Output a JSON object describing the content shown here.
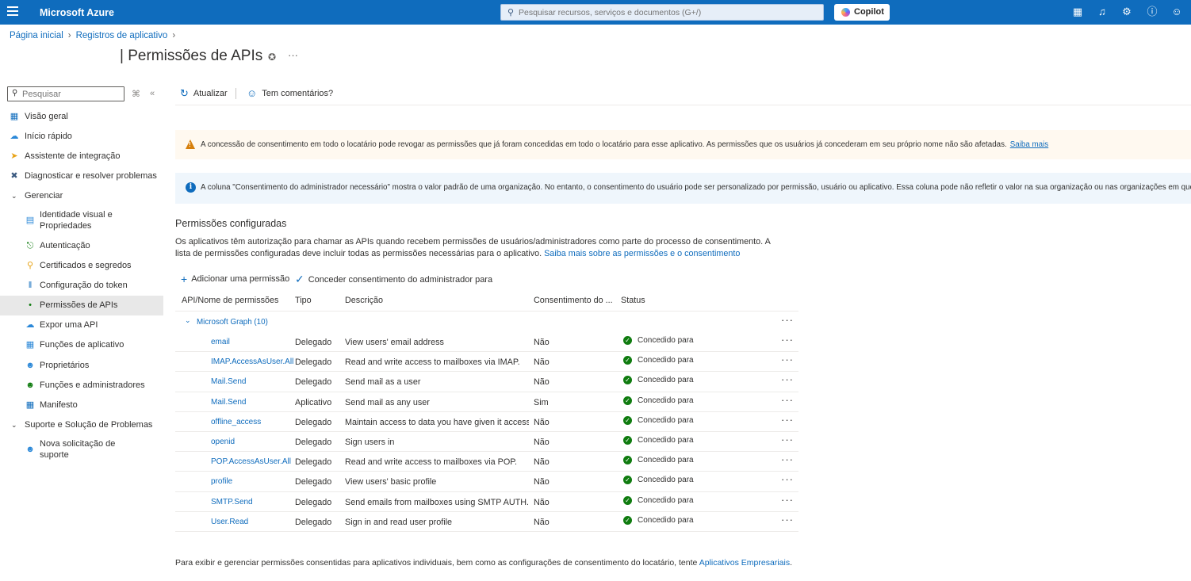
{
  "topbar": {
    "brand": "Microsoft Azure",
    "search_placeholder": "Pesquisar recursos, serviços e documentos (G+/)",
    "copilot_label": "Copilot",
    "bg_color": "#0f6cbd"
  },
  "breadcrumb": {
    "home": "Página inicial",
    "app_registrations": "Registros de aplicativo"
  },
  "page": {
    "title": "| Permissões de APIs"
  },
  "sidebar": {
    "search_placeholder": "Pesquisar",
    "items": [
      {
        "label": "Visão geral",
        "icon": "overview-icon"
      },
      {
        "label": "Início rápido",
        "icon": "quickstart-icon"
      },
      {
        "label": "Assistente de integração",
        "icon": "rocket-icon"
      },
      {
        "label": "Diagnosticar e resolver problemas",
        "icon": "wrench-icon"
      }
    ],
    "group_manage": "Gerenciar",
    "manage_items": [
      {
        "label": "Identidade visual e Propriedades",
        "icon": "branding-icon"
      },
      {
        "label": "Autenticação",
        "icon": "auth-icon"
      },
      {
        "label": "Certificados e segredos",
        "icon": "key-icon"
      },
      {
        "label": "Configuração do token",
        "icon": "token-icon"
      },
      {
        "label": "Permissões de APIs",
        "icon": "api-permissions-icon"
      },
      {
        "label": "Expor uma API",
        "icon": "cloud-icon"
      },
      {
        "label": "Funções de aplicativo",
        "icon": "app-roles-icon"
      },
      {
        "label": "Proprietários",
        "icon": "owners-icon"
      },
      {
        "label": "Funções e administradores",
        "icon": "roles-admins-icon"
      },
      {
        "label": "Manifesto",
        "icon": "manifest-icon"
      }
    ],
    "group_support": "Suporte e Solução de Problemas",
    "support_items": [
      {
        "label": "Nova solicitação de suporte",
        "icon": "support-person-icon"
      }
    ]
  },
  "commands": {
    "refresh": "Atualizar",
    "feedback": "Tem comentários?"
  },
  "banners": {
    "warning_text": "A concessão de consentimento em todo o locatário pode revogar as permissões que já foram concedidas em todo o locatário para esse aplicativo. As permissões que os usuários já concederam em seu próprio nome não são afetadas.",
    "warning_link": "Saiba mais",
    "info_text": "A coluna \"Consentimento do administrador necessário\" mostra o valor padrão de uma organização. No entanto, o consentimento do usuário pode ser personalizado por permissão, usuário ou aplicativo. Essa coluna pode não refletir o valor na sua organização ou nas organizações em que esse aplicativo será usado."
  },
  "section": {
    "title": "Permissões configuradas",
    "description": "Os aplicativos têm autorização para chamar as APIs quando recebem permissões de usuários/administradores como parte do processo de consentimento. A lista de permissões configuradas deve incluir todas as permissões necessárias para o aplicativo.",
    "link": "Saiba mais sobre as permissões e o consentimento",
    "add_permission": "Adicionar uma permissão",
    "grant_consent": "Conceder consentimento do administrador para"
  },
  "table": {
    "headers": {
      "name": "API/Nome de permissões",
      "type": "Tipo",
      "description": "Descrição",
      "consent": "Consentimento do ...",
      "status": "Status"
    },
    "group_label": "Microsoft Graph (10)",
    "rows": [
      {
        "name": "email",
        "type": "Delegado",
        "description": "View users' email address",
        "consent": "Não",
        "status": "Concedido para"
      },
      {
        "name": "IMAP.AccessAsUser.All",
        "type": "Delegado",
        "description": "Read and write access to mailboxes via IMAP.",
        "consent": "Não",
        "status": "Concedido para"
      },
      {
        "name": "Mail.Send",
        "type": "Delegado",
        "description": "Send mail as a user",
        "consent": "Não",
        "status": "Concedido para"
      },
      {
        "name": "Mail.Send",
        "type": "Aplicativo",
        "description": "Send mail as any user",
        "consent": "Sim",
        "status": "Concedido para"
      },
      {
        "name": "offline_access",
        "type": "Delegado",
        "description": "Maintain access to data you have given it access to",
        "consent": "Não",
        "status": "Concedido para"
      },
      {
        "name": "openid",
        "type": "Delegado",
        "description": "Sign users in",
        "consent": "Não",
        "status": "Concedido para"
      },
      {
        "name": "POP.AccessAsUser.All",
        "type": "Delegado",
        "description": "Read and write access to mailboxes via POP.",
        "consent": "Não",
        "status": "Concedido para"
      },
      {
        "name": "profile",
        "type": "Delegado",
        "description": "View users' basic profile",
        "consent": "Não",
        "status": "Concedido para"
      },
      {
        "name": "SMTP.Send",
        "type": "Delegado",
        "description": "Send emails from mailboxes using SMTP AUTH.",
        "consent": "Não",
        "status": "Concedido para"
      },
      {
        "name": "User.Read",
        "type": "Delegado",
        "description": "Sign in and read user profile",
        "consent": "Não",
        "status": "Concedido para"
      }
    ]
  },
  "footer": {
    "text": "Para exibir e gerenciar permissões consentidas para aplicativos individuais, bem como as configurações de consentimento do locatário, tente",
    "link": "Aplicativos Empresariais",
    "end": "."
  }
}
